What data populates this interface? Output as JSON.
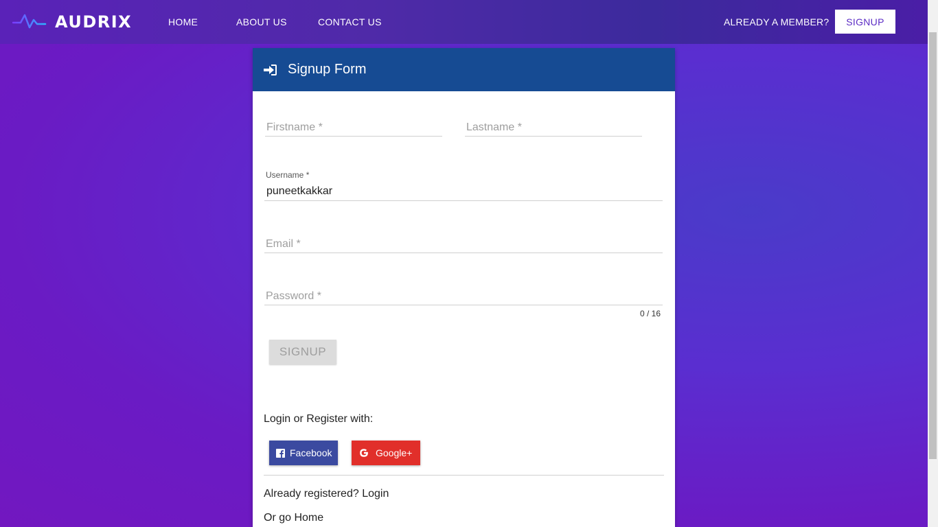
{
  "nav": {
    "brand": "AUDRIX",
    "links": [
      "HOME",
      "ABOUT US",
      "CONTACT US"
    ],
    "member_text": "ALREADY A MEMBER?",
    "signup_label": "SIGNUP"
  },
  "form": {
    "title": "Signup Form",
    "firstname_label": "Firstname *",
    "lastname_label": "Lastname *",
    "username_label": "Username *",
    "username_value": "puneetkakkar",
    "email_label": "Email *",
    "password_label": "Password *",
    "password_counter": "0 / 16",
    "submit_label": "SIGNUP",
    "social_label": "Login or Register with:",
    "facebook_label": "Facebook",
    "google_label": "Google+",
    "already_registered": "Already registered? Login",
    "go_home": "Or go Home"
  },
  "colors": {
    "header": "#164b93",
    "facebook": "#3b4aa0",
    "google": "#e12f2a",
    "accent": "#5b2bc4"
  }
}
